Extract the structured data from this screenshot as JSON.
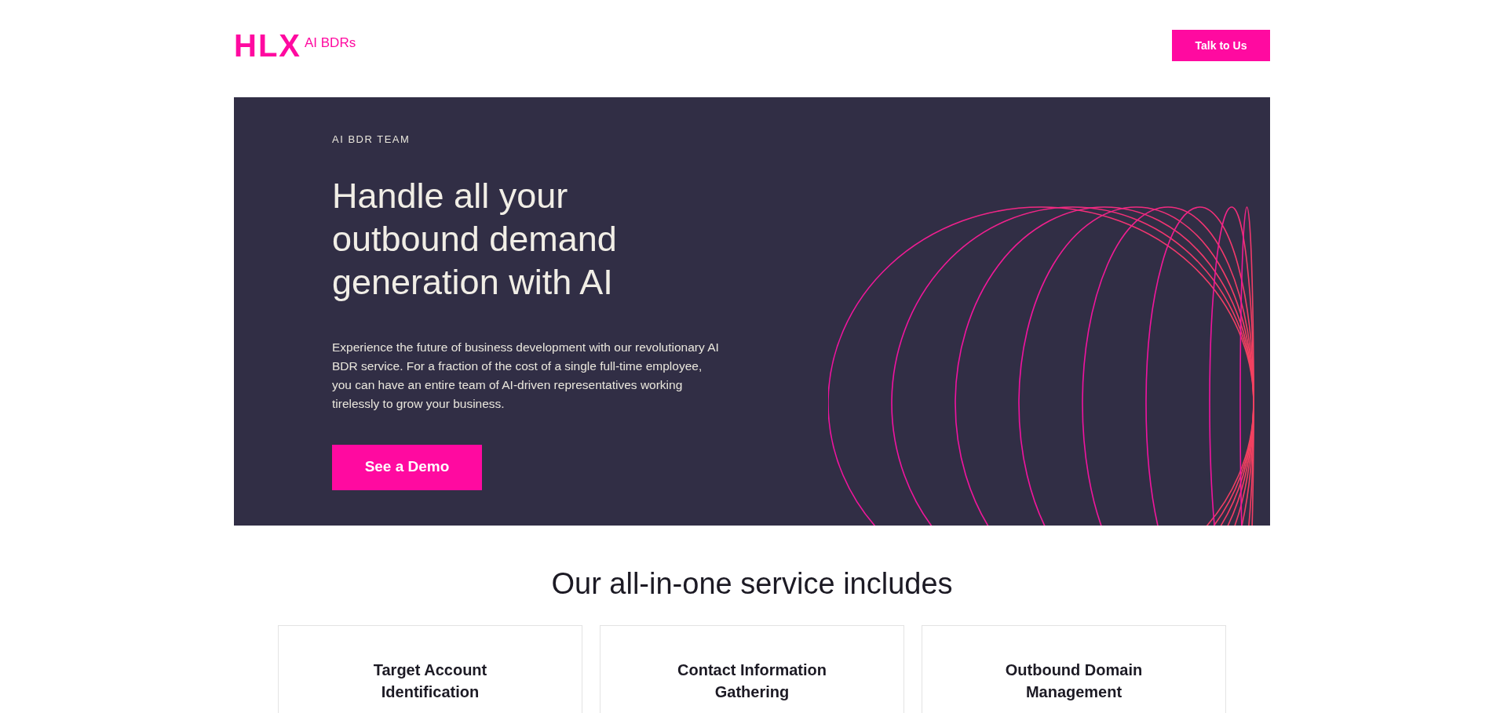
{
  "header": {
    "logo": "HLX",
    "tagline": "AI BDRs",
    "cta": "Talk to Us"
  },
  "hero": {
    "eyebrow": "AI BDR TEAM",
    "heading": "Handle all your outbound demand generation with AI",
    "body": "Experience the future of business development with our revolutionary AI BDR service. For a fraction of the cost of a single full-time employee, you can have an entire team of AI-driven representatives working tirelessly to grow your business.",
    "button": "See a Demo"
  },
  "services": {
    "title": "Our all-in-one service includes",
    "cards": [
      {
        "title": "Target Account Identification"
      },
      {
        "title": "Contact Information Gathering"
      },
      {
        "title": "Outbound Domain Management"
      }
    ]
  }
}
